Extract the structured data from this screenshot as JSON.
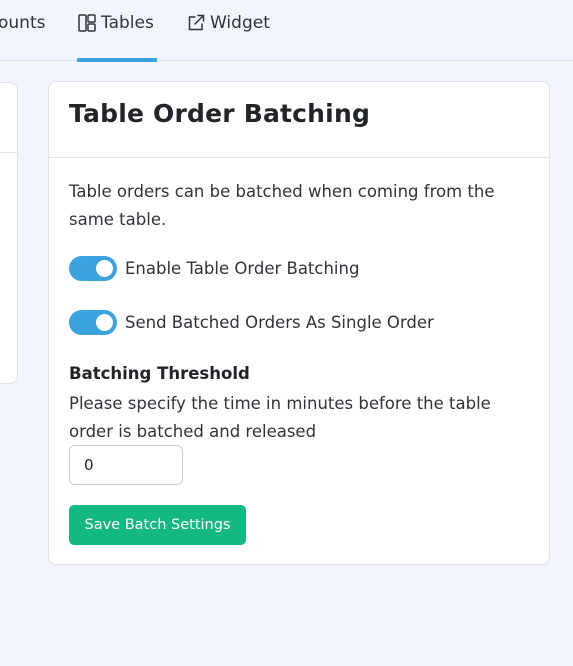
{
  "tabs": {
    "discounts_label": "ounts",
    "tables_label": "Tables",
    "widget_label": "Widget"
  },
  "card": {
    "title": "Table Order Batching",
    "description": "Table orders can be batched when coming from the same table.",
    "toggle_batching_label": "Enable Table Order Batching",
    "toggle_batching_on": true,
    "toggle_single_order_label": "Send Batched Orders As Single Order",
    "toggle_single_order_on": true,
    "threshold_label": "Batching Threshold",
    "threshold_help": "Please specify the time in minutes before the table order is batched and released",
    "threshold_value": "0",
    "save_label": "Save Batch Settings"
  },
  "colors": {
    "accent": "#3aa3dd",
    "save_button": "#13b97e",
    "background": "#f3f5fd"
  },
  "icons": {
    "tables_tab": "layout-grid-icon",
    "widget_tab": "external-link-icon"
  }
}
